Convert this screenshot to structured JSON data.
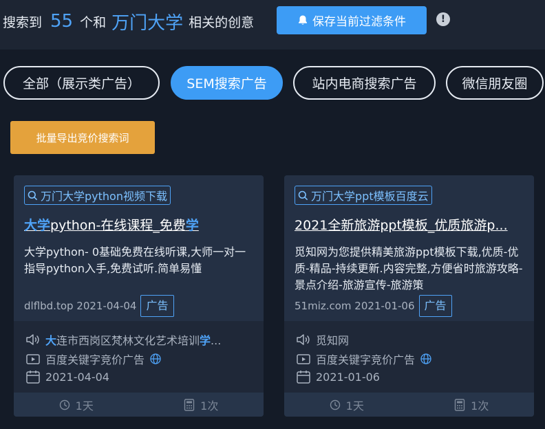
{
  "header": {
    "prefix": "搜索到",
    "count": "55",
    "middle": "个和",
    "keyword": "万门大学",
    "suffix": "相关的创意",
    "save_label": "保存当前过滤条件",
    "alert_icon": "!"
  },
  "tabs": [
    {
      "label": "全部（展示类广告）",
      "active": false
    },
    {
      "label": "SEM搜索广告",
      "active": true
    },
    {
      "label": "站内电商搜索广告",
      "active": false
    },
    {
      "label": "微信朋友圈",
      "active": false
    }
  ],
  "export_label": "批量导出竞价搜索词",
  "cards": [
    {
      "keyword_tag": "万门大学python视频下载",
      "title_hl1": "大学",
      "title_mid": "python-在线课程_免费",
      "title_hl2": "学",
      "title_rest": "",
      "description": "大学python- 0基础免费在线听课,大师一对一指导python入手,免费试听.简单易懂",
      "domain_date": "dlflbd.top 2021-04-04",
      "ad_label": "广告",
      "advertiser_hl1": "大",
      "advertiser_mid": "连市西岗区梵林文化艺术培训",
      "advertiser_hl2": "学",
      "advertiser_rest": "...",
      "platform": "百度关键字竞价广告",
      "date": "2021-04-04",
      "duration": "1天",
      "times": "1次"
    },
    {
      "keyword_tag": "万门大学ppt模板百度云",
      "title_hl1": "",
      "title_mid": "2021全新旅游ppt模板_优质旅游p...",
      "title_hl2": "",
      "title_rest": "",
      "description": "觅知网为您提供精美旅游ppt模板下载,优质-优质-精品-持续更新.内容完整,方便省时旅游攻略-景点介绍-旅游宣传-旅游策",
      "domain_date": "51miz.com 2021-01-06",
      "ad_label": "广告",
      "advertiser_hl1": "",
      "advertiser_mid": "觅知网",
      "advertiser_hl2": "",
      "advertiser_rest": "",
      "platform": "百度关键字竞价广告",
      "date": "2021-01-06",
      "duration": "1天",
      "times": "1次"
    }
  ],
  "colors": {
    "accent": "#3d9cf5",
    "export": "#e4a23c",
    "background": "#141b27"
  }
}
